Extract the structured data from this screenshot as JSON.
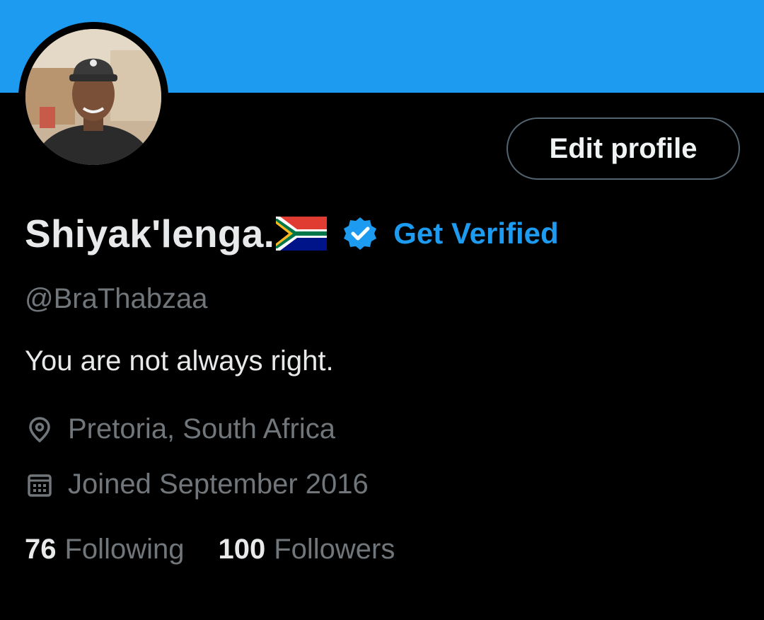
{
  "colors": {
    "banner": "#1d9bf0",
    "accent": "#1d9bf0",
    "background": "#000000",
    "primary_text": "#e7e9ea",
    "secondary_text": "#71767b"
  },
  "profile": {
    "display_name": "Shiyak'lenga.",
    "flag_icon": "south-africa-flag-icon",
    "verified_icon": "verified-badge-icon",
    "get_verified_label": "Get Verified",
    "handle": "@BraThabzaa",
    "bio": "You are not always right.",
    "location": "Pretoria, South Africa",
    "location_icon": "location-pin-icon",
    "joined": "Joined September 2016",
    "joined_icon": "calendar-icon"
  },
  "actions": {
    "edit_profile_label": "Edit profile"
  },
  "stats": {
    "following_count": "76",
    "following_label": "Following",
    "followers_count": "100",
    "followers_label": "Followers"
  }
}
